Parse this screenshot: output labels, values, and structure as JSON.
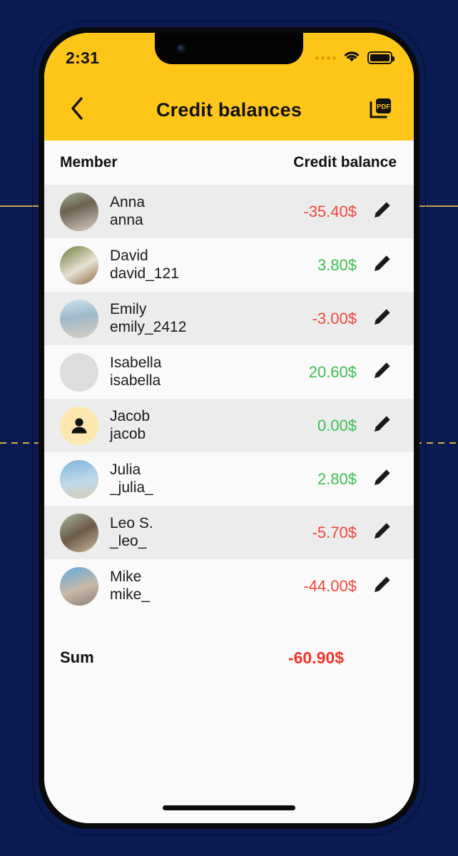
{
  "status_bar": {
    "time": "2:31",
    "signal_icon": "signal-dots-icon",
    "wifi_icon": "wifi-icon",
    "battery_icon": "battery-full-icon"
  },
  "app_bar": {
    "back_icon": "chevron-left-icon",
    "title": "Credit balances",
    "export_icon": "pdf-export-icon",
    "export_label": "PDF"
  },
  "table": {
    "headers": {
      "member": "Member",
      "balance": "Credit balance"
    },
    "rows": [
      {
        "name": "Anna",
        "username": "anna",
        "balance": "-35.40$",
        "sign": "neg",
        "avatar": "photo",
        "edit_icon": "pencil-icon"
      },
      {
        "name": "David",
        "username": "david_121",
        "balance": "3.80$",
        "sign": "pos",
        "avatar": "photo",
        "edit_icon": "pencil-icon"
      },
      {
        "name": "Emily",
        "username": "emily_2412",
        "balance": "-3.00$",
        "sign": "neg",
        "avatar": "photo",
        "edit_icon": "pencil-icon"
      },
      {
        "name": "Isabella",
        "username": "isabella",
        "balance": "20.60$",
        "sign": "pos",
        "avatar": "photo",
        "edit_icon": "pencil-icon"
      },
      {
        "name": "Jacob",
        "username": "jacob",
        "balance": "0.00$",
        "sign": "pos",
        "avatar": "placeholder",
        "edit_icon": "pencil-icon"
      },
      {
        "name": "Julia",
        "username": "_julia_",
        "balance": "2.80$",
        "sign": "pos",
        "avatar": "photo",
        "edit_icon": "pencil-icon"
      },
      {
        "name": "Leo S.",
        "username": "_leo_",
        "balance": "-5.70$",
        "sign": "neg",
        "avatar": "photo",
        "edit_icon": "pencil-icon"
      },
      {
        "name": "Mike",
        "username": "mike_",
        "balance": "-44.00$",
        "sign": "neg",
        "avatar": "photo",
        "edit_icon": "pencil-icon"
      }
    ],
    "summary": {
      "label": "Sum",
      "value": "-60.90$",
      "sign": "neg"
    }
  },
  "colors": {
    "brand_yellow": "#FFC61A",
    "negative_red": "#F0463C",
    "positive_green": "#3BBF4E",
    "sum_red": "#F0352B",
    "row_alt": "#ECECEC",
    "row_plain": "#FAFAFA",
    "backdrop_navy": "#0A1B52"
  },
  "home_indicator": "home-indicator"
}
